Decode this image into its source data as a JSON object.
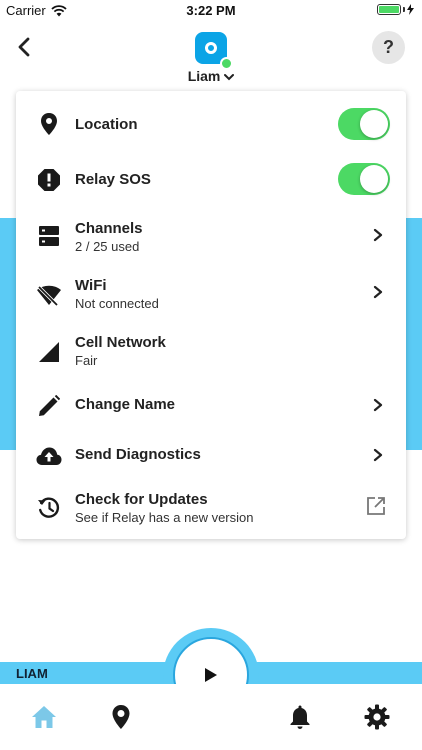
{
  "status_bar": {
    "carrier": "Carrier",
    "time": "3:22 PM"
  },
  "header": {
    "device_name": "Liam",
    "help_label": "?"
  },
  "settings": [
    {
      "title": "Location",
      "toggle": true
    },
    {
      "title": "Relay SOS",
      "toggle": true
    },
    {
      "title": "Channels",
      "subtitle": "2 / 25 used"
    },
    {
      "title": "WiFi",
      "subtitle": "Not connected"
    },
    {
      "title": "Cell Network",
      "subtitle": "Fair"
    },
    {
      "title": "Change Name"
    },
    {
      "title": "Send Diagnostics"
    },
    {
      "title": "Check for Updates",
      "subtitle": "See if Relay has a new version"
    }
  ],
  "bottom": {
    "label": "LIAM"
  },
  "colors": {
    "accent": "#0ba4e6",
    "band": "#5bcbf5",
    "toggle_on": "#4cd964",
    "icon": "#1a1a1a"
  }
}
